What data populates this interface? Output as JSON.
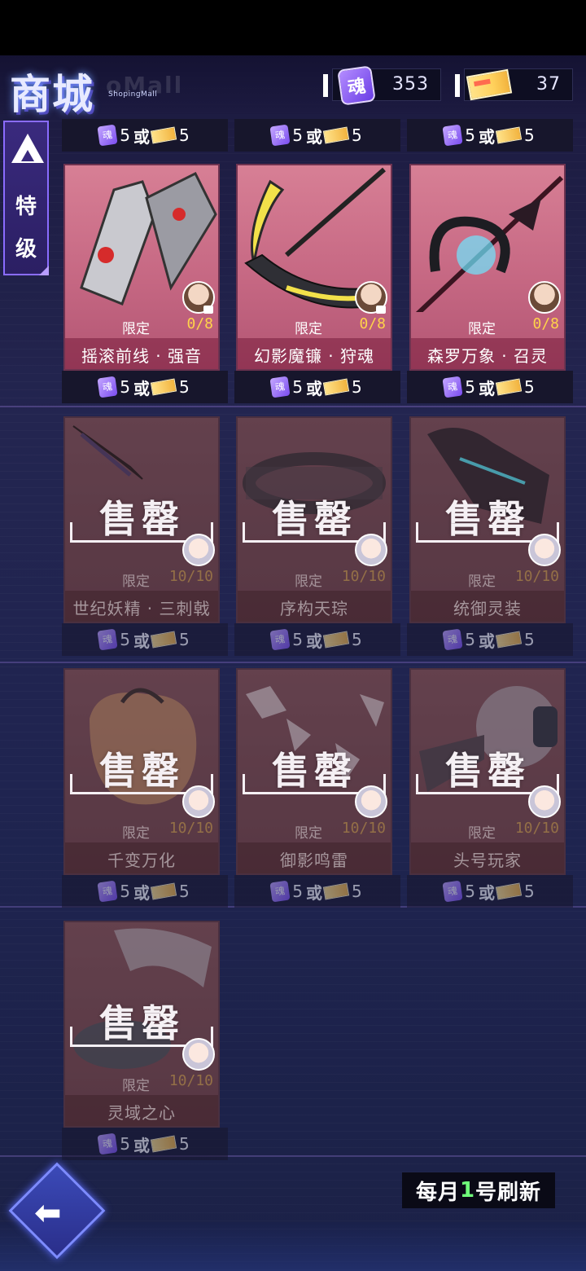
{
  "header": {
    "title": "商城",
    "subtitle": "ShopingMall",
    "watermark": "oMall",
    "soul_currency": "353",
    "ticket_currency": "37",
    "soul_icon_char": "魂"
  },
  "side_tab": {
    "label_line1": "特",
    "label_line2": "级"
  },
  "price_text": {
    "amount": "5",
    "or": "或",
    "soul_char": "魂"
  },
  "sold_out_label": "售罄",
  "limited_label": "限定",
  "items": [
    {
      "name": "摇滚前线 · 强音",
      "count": "0/8",
      "status": "available"
    },
    {
      "name": "幻影魔镰 · 狩魂",
      "count": "0/8",
      "status": "available"
    },
    {
      "name": "森罗万象 · 召灵",
      "count": "0/8",
      "status": "available"
    },
    {
      "name": "世纪妖精 · 三刺戟",
      "count": "10/10",
      "status": "sold"
    },
    {
      "name": "序构天琮",
      "count": "10/10",
      "status": "sold"
    },
    {
      "name": "统御灵装",
      "count": "10/10",
      "status": "sold"
    },
    {
      "name": "千变万化",
      "count": "10/10",
      "status": "sold"
    },
    {
      "name": "御影鸣雷",
      "count": "10/10",
      "status": "sold"
    },
    {
      "name": "头号玩家",
      "count": "10/10",
      "status": "sold"
    },
    {
      "name": "灵域之心",
      "count": "10/10",
      "status": "sold"
    }
  ],
  "footer": {
    "refresh_prefix": "每月",
    "refresh_day": "1",
    "refresh_suffix": "号刷新",
    "back_arrow": "⬅"
  },
  "colors": {
    "accent": "#8a6cff",
    "count_gold": "#ffd34a",
    "card_pink": "#c66883"
  }
}
